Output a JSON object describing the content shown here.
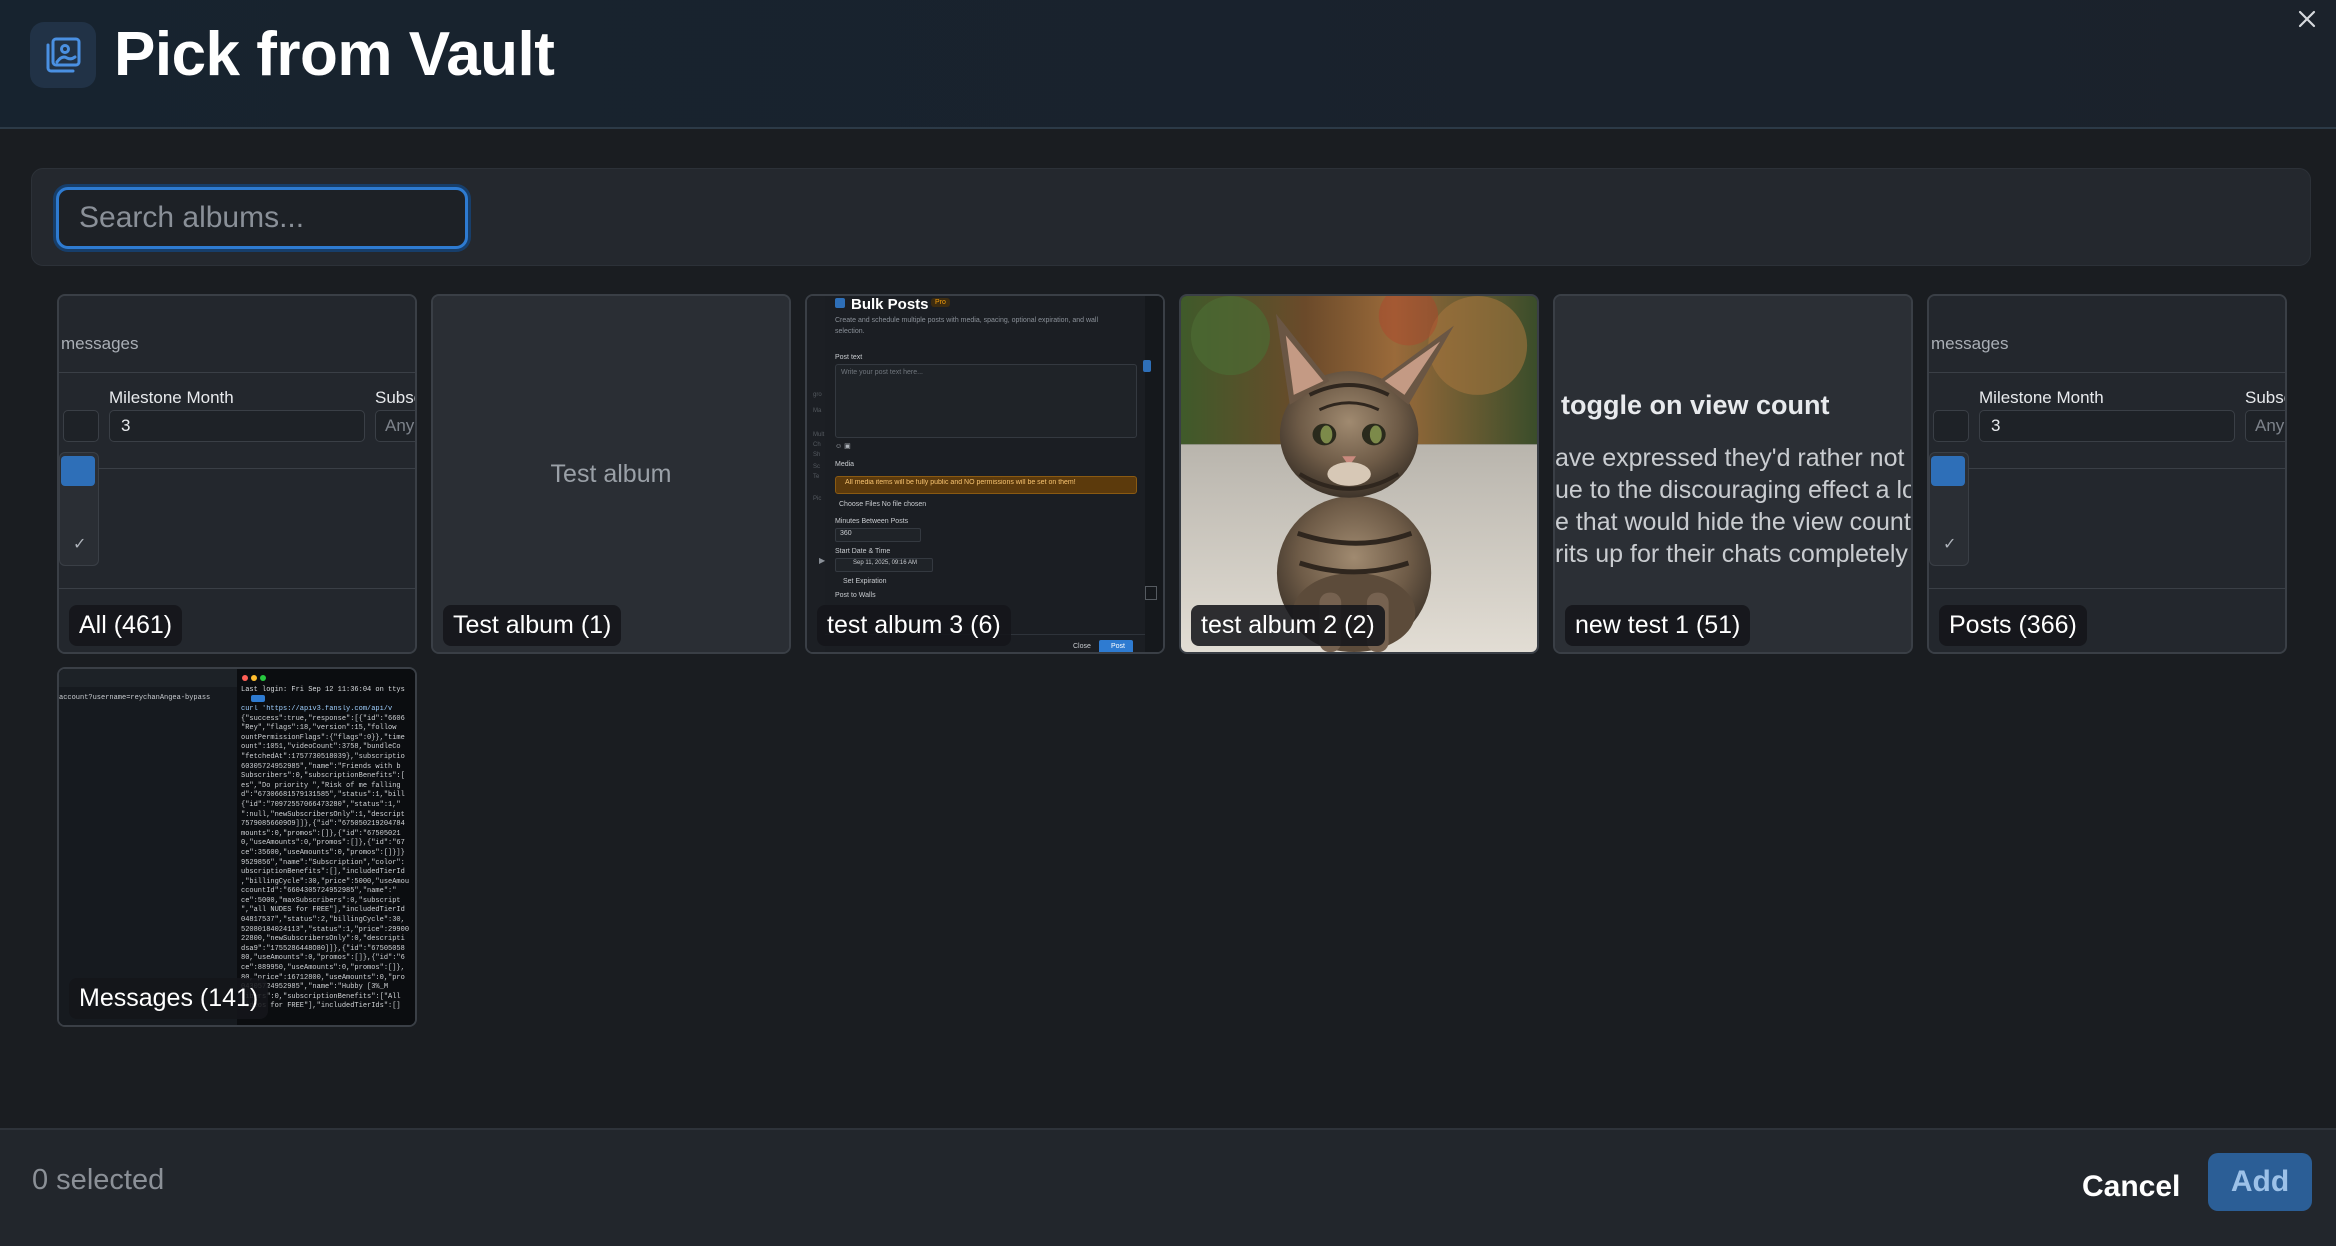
{
  "header": {
    "title": "Pick from Vault",
    "icon": "photo-album-icon",
    "close_icon": "close-icon"
  },
  "search": {
    "placeholder": "Search albums...",
    "value": ""
  },
  "albums": [
    {
      "label": "All (461)",
      "preview": {
        "type": "ui-form-crop",
        "section_text": "messages",
        "field_label": "Milestone Month",
        "field_value": "3",
        "next_field_label": "Subsc",
        "next_field_value": "Any"
      }
    },
    {
      "label": "Test album (1)",
      "preview": {
        "type": "text-placeholder",
        "text": "Test album"
      }
    },
    {
      "label": "test album 3 (6)",
      "preview": {
        "type": "bulk-posts-screenshot",
        "heading": "Bulk Posts",
        "badge": "Pro",
        "description": "Create and schedule multiple posts with media, spacing, optional expiration, and wall selection.",
        "post_text_label": "Post text",
        "post_text_placeholder": "Write your post text here...",
        "media_label": "Media",
        "warning": "All media items will be fully public and NO permissions will be set on them!",
        "choose_files": "Choose Files  No file chosen",
        "minutes_label": "Minutes Between Posts",
        "minutes_value": "360",
        "start_label": "Start Date & Time",
        "start_value": "Sep 11, 2025, 09:16 AM",
        "expiration_label": "Set Expiration",
        "walls_label": "Post to Walls",
        "close_label": "Close",
        "post_label": "Post"
      }
    },
    {
      "label": "test album 2 (2)",
      "preview": {
        "type": "photo",
        "subject": "kitten"
      }
    },
    {
      "label": "new test 1 (51)",
      "preview": {
        "type": "text-crop",
        "heading": "toggle on view count",
        "lines": [
          "ave expressed they'd rather not b",
          "ue to the discouraging effect a lov",
          "e that would hide the view count v",
          "rits up for their chats completely"
        ]
      }
    },
    {
      "label": "Posts (366)",
      "preview": {
        "type": "ui-form-crop",
        "section_text": "messages",
        "field_label": "Milestone Month",
        "field_value": "3",
        "next_field_label": "Subsc",
        "next_field_value": "Any"
      }
    },
    {
      "label": "Messages (141)",
      "preview": {
        "type": "terminal-screenshot",
        "login_line": "Last login: Fri Sep 12 11:36:04 on ttys",
        "url_line": "account?username=reychanAngea-bypass",
        "code_lines": [
          "curl 'https://apiv3.fansly.com/api/v",
          "{\"success\":true,\"response\":[{\"id\":\"6606",
          "\"Rey\",\"flags\":18,\"version\":15,\"follow",
          "ountPermissionFlags\":{\"flags\":0}},\"time",
          "ount\":1051,\"videoCount\":3758,\"bundleCo",
          "\"fetchedAt\":1757730518039},\"subscriptio",
          "60305724952985\",\"name\":\"Friends with b",
          "Subscribers\":0,\"subscriptionBenefits\":[",
          "es\",\"Do priority \",\"Risk of me falling",
          "d\":\"67306681579131585\",\"status\":1,\"bill",
          "{\"id\":\"70972557066473280\",\"status\":1,\"",
          "\":null,\"newSubscribersOnly\":1,\"descript",
          "75790856609O9]]},{\"id\":\"675050219204784",
          "mounts\":0,\"promos\":[]},{\"id\":\"67505021",
          "0,\"useAmounts\":0,\"promos\":[]},{\"id\":\"67",
          "ce\":35600,\"useAmounts\":0,\"promos\":[]}]}",
          "9529856\",\"name\":\"Subscription\",\"color\":",
          "ubscriptionBenefits\":[],\"includedTierId",
          ",\"billingCycle\":30,\"price\":5000,\"useAmou",
          "ccountId\":\"6604305724952985\",\"name\":\"",
          "ce\":5000,\"maxSubscribers\":0,\"subscript",
          "\",\"all NUDES for FREE\"],\"includedTierId",
          "04817537\",\"status\":2,\"billingCycle\":30,",
          "52080184024113\",\"status\":1,\"price\":29900",
          "22800,\"newSubscribersOnly\":0,\"descripti",
          "dsa9\":\"1755286448O80]]},{\"id\":\"67505058",
          "80,\"useAmounts\":0,\"promos\":[]},{\"id\":\"6",
          "ce\":889950,\"useAmounts\":0,\"promos\":[]},",
          "80,\"price\":16712800,\"useAmounts\":0,\"pro",
          "04305724952985\",\"name\":\"Hubby [3%_M",
          "ribers\":0,\"subscriptionBenefits\":[\"All",
          " videos for FREE\"],\"includedTierIds\":[]"
        ]
      }
    }
  ],
  "footer": {
    "selected_text": "0 selected",
    "cancel_label": "Cancel",
    "add_label": "Add"
  },
  "colors": {
    "accent": "#2e7bd1",
    "add_button": "#2b5e96",
    "background": "#1a1d21",
    "warning": "#f59e0b"
  }
}
